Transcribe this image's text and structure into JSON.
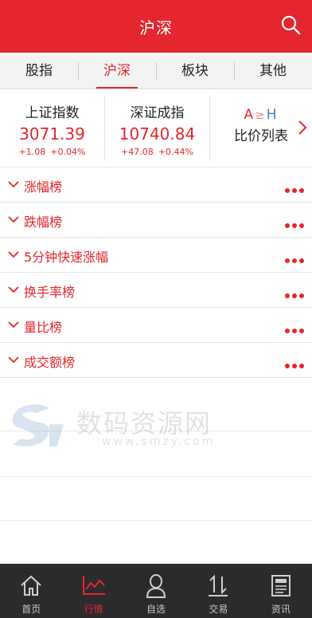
{
  "header": {
    "title": "沪深",
    "search_icon": "search-icon"
  },
  "tabs": [
    {
      "label": "股指",
      "active": false
    },
    {
      "label": "沪深",
      "active": true
    },
    {
      "label": "板块",
      "active": false
    },
    {
      "label": "其他",
      "active": false
    }
  ],
  "indices": [
    {
      "name": "上证指数",
      "value": "3071.39",
      "change": "+1.08",
      "pct": "+0.04%"
    },
    {
      "name": "深证成指",
      "value": "10740.84",
      "change": "+47.08",
      "pct": "+0.44%"
    }
  ],
  "ah": {
    "logo_a": "A",
    "logo_z": "≥",
    "logo_h": "H",
    "label": "比价列表"
  },
  "rankings": [
    {
      "label": "涨幅榜"
    },
    {
      "label": "跌幅榜"
    },
    {
      "label": "5分钟快速涨幅"
    },
    {
      "label": "换手率榜"
    },
    {
      "label": "量比榜"
    },
    {
      "label": "成交额榜"
    }
  ],
  "watermark": {
    "text": "数码资源网",
    "url": "www.smzy.com"
  },
  "tabbar": [
    {
      "label": "首页",
      "icon": "home-icon",
      "active": false
    },
    {
      "label": "行情",
      "icon": "chart-icon",
      "active": true
    },
    {
      "label": "自选",
      "icon": "user-icon",
      "active": false
    },
    {
      "label": "交易",
      "icon": "transfer-icon",
      "active": false
    },
    {
      "label": "资讯",
      "icon": "news-icon",
      "active": false
    }
  ],
  "colors": {
    "brand_red": "#e4262e",
    "tabbar_bg": "#2b2b2e",
    "ah_blue": "#3a87d0"
  }
}
